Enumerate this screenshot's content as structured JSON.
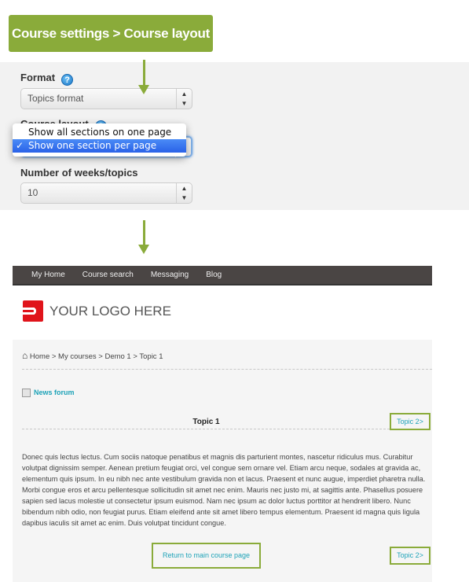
{
  "banner": {
    "title": "Course settings > Course layout"
  },
  "settings": {
    "format_label": "Format",
    "format_value": "Topics format",
    "layout_label": "Course layout",
    "layout_options": [
      "Show all sections on one page",
      "Show one section per page"
    ],
    "layout_selected_check": "✓",
    "weeks_label": "Number of weeks/topics",
    "weeks_value": "10",
    "help_glyph": "?"
  },
  "site": {
    "nav": [
      "My Home",
      "Course search",
      "Messaging",
      "Blog"
    ],
    "logo_text": "YOUR LOGO HERE",
    "breadcrumb": "Home > My courses > Demo 1 > Topic 1",
    "news_forum": "News forum",
    "topic_title": "Topic 1",
    "next_topic": "Topic 2>",
    "paragraph": "Donec quis lectus lectus. Cum sociis natoque penatibus et magnis dis parturient montes, nascetur ridiculus mus. Curabitur volutpat dignissim semper. Aenean pretium feugiat orci, vel congue sem ornare vel. Etiam arcu neque, sodales at gravida ac, elementum quis ipsum. In eu nibh nec ante vestibulum gravida non et lacus. Praesent et nunc augue, imperdiet pharetra nulla. Morbi congue eros et arcu pellentesque sollicitudin sit amet nec enim. Mauris nec justo mi, at sagittis ante. Phasellus posuere sapien sed lacus molestie ut consectetur ipsum euismod. Nam nec ipsum ac dolor luctus porttitor at hendrerit libero. Nunc bibendum nibh odio, non feugiat purus. Etiam eleifend ante sit amet libero tempus elementum. Praesent id magna quis ligula dapibus iaculis sit amet ac enim. Duis volutpat tincidunt congue.",
    "return_link": "Return to main course page"
  },
  "colors": {
    "accent": "#8aab3a",
    "link": "#1fa3b8",
    "nav_bg": "#4a4544",
    "logo_red": "#e0141b",
    "select_highlight": "#2a62e8"
  }
}
